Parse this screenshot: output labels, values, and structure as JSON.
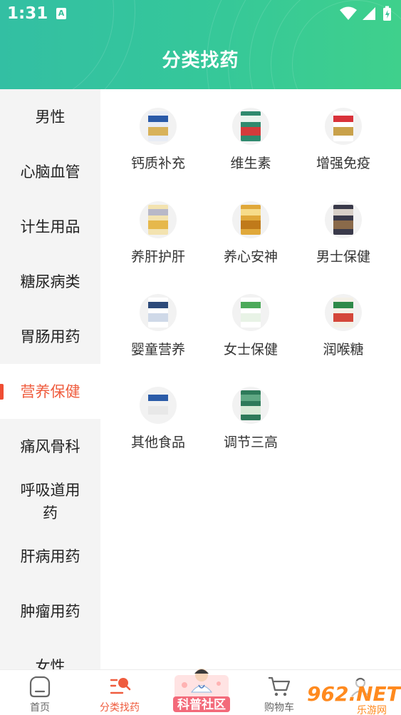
{
  "status_bar": {
    "time": "1:31",
    "notification_letter": "A"
  },
  "header": {
    "title": "分类找药"
  },
  "sidebar": {
    "active_index": 5,
    "items": [
      {
        "label": "男性"
      },
      {
        "label": "心脑血管"
      },
      {
        "label": "计生用品"
      },
      {
        "label": "糖尿病类"
      },
      {
        "label": "胃肠用药"
      },
      {
        "label": "营养保健"
      },
      {
        "label": "痛风骨科"
      },
      {
        "label": "呼吸道用药"
      },
      {
        "label": "肝病用药"
      },
      {
        "label": "肿瘤用药"
      },
      {
        "label": "女性"
      }
    ]
  },
  "grid": {
    "items": [
      {
        "label": "钙质补充",
        "colors": [
          "#e8ecf5",
          "#2a5aa8",
          "#d8b25a"
        ]
      },
      {
        "label": "维生素",
        "colors": [
          "#2f8a6e",
          "#e9f4ee",
          "#d43b3b"
        ]
      },
      {
        "label": "增强免疫",
        "colors": [
          "#ffffff",
          "#d9323a",
          "#c9a14a"
        ]
      },
      {
        "label": "养肝护肝",
        "colors": [
          "#f3e3b0",
          "#b8b8c8",
          "#e6b84c"
        ]
      },
      {
        "label": "养心安神",
        "colors": [
          "#e0a83a",
          "#f7dc8a",
          "#c07a1a"
        ]
      },
      {
        "label": "男士保健",
        "colors": [
          "#3a3a4a",
          "#d8d0c8",
          "#8a6a4a"
        ]
      },
      {
        "label": "婴童营养",
        "colors": [
          "#ffffff",
          "#2d4a7a",
          "#cfd9e8"
        ]
      },
      {
        "label": "女士保健",
        "colors": [
          "#ffffff",
          "#4caa5a",
          "#e8f3e6"
        ]
      },
      {
        "label": "润喉糖",
        "colors": [
          "#f4f0e6",
          "#2e8a4a",
          "#d4473a"
        ]
      },
      {
        "label": "其他食品",
        "colors": [
          "#f2f2f2",
          "#2b5ca8",
          "#e8e8e8"
        ]
      },
      {
        "label": "调节三高",
        "colors": [
          "#2e7a5a",
          "#5fa884",
          "#d9ead8"
        ]
      }
    ]
  },
  "tabbar": {
    "active_index": 1,
    "items": [
      {
        "label": "首页",
        "icon": "home-icon"
      },
      {
        "label": "分类找药",
        "icon": "category-search-icon"
      },
      {
        "label": "科普社区",
        "icon": "doctor-badge-icon"
      },
      {
        "label": "购物车",
        "icon": "cart-icon"
      },
      {
        "label": "",
        "icon": "user-icon"
      }
    ]
  },
  "watermark": {
    "text": "962.NET",
    "subtext": "乐游网"
  },
  "colors": {
    "header_start": "#33bfa3",
    "header_end": "#3fd08c",
    "accent": "#ef5c3e",
    "sidebar_bg": "#f4f4f4"
  }
}
